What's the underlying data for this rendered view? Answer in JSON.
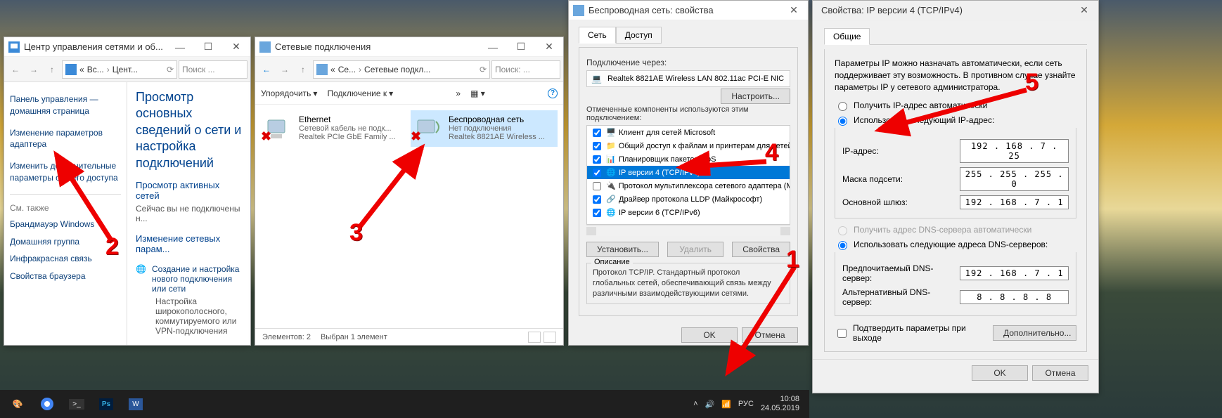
{
  "win1": {
    "title": "Центр управления сетями и об...",
    "breadcrumb": {
      "p1": "Вс...",
      "p2": "Цент..."
    },
    "search_placeholder": "Поиск ...",
    "left": {
      "home": "Панель управления — домашняя страница",
      "adapter": "Изменение параметров адаптера",
      "sharing": "Изменить дополнительные параметры общего доступа",
      "see_also": "См. также",
      "firewall": "Брандмауэр Windows",
      "homegroup": "Домашняя группа",
      "infrared": "Инфракрасная связь",
      "browser": "Свойства браузера"
    },
    "right": {
      "heading": "Просмотр основных сведений о сети и настройка подключений",
      "sub1": "Просмотр активных сетей",
      "sub1b": "Сейчас вы не подключены н...",
      "sub2": "Изменение сетевых парам...",
      "task1": "Создание и настройка нового подключения или сети",
      "task1desc": "Настройка широкополосного, коммутируемого или VPN-подключения"
    }
  },
  "win2": {
    "title": "Сетевые подключения",
    "breadcrumb": {
      "p1": "Се...",
      "p2": "Сетевые подкл..."
    },
    "search_placeholder": "Поиск: ...",
    "menu": {
      "org": "Упорядочить",
      "connect": "Подключение к"
    },
    "adapters": [
      {
        "name": "Ethernet",
        "state": "Сетевой кабель не подк...",
        "dev": "Realtek PCIe GbE Family ..."
      },
      {
        "name": "Беспроводная сеть",
        "state": "Нет подключения",
        "dev": "Realtek 8821AE Wireless ..."
      }
    ],
    "status": {
      "count": "Элементов: 2",
      "sel": "Выбран 1 элемент"
    }
  },
  "win3": {
    "title": "Беспроводная сеть: свойства",
    "tabs": {
      "net": "Сеть",
      "access": "Доступ"
    },
    "conn_via": "Подключение через:",
    "adapter": "Realtek 8821AE Wireless LAN 802.11ac PCI-E NIC",
    "configure": "Настроить...",
    "comp_label": "Отмеченные компоненты используются этим подключением:",
    "components": [
      {
        "checked": true,
        "label": "Клиент для сетей Microsoft"
      },
      {
        "checked": true,
        "label": "Общий доступ к файлам и принтерам для сетей Micro"
      },
      {
        "checked": true,
        "label": "Планировщик пакетов QoS"
      },
      {
        "checked": true,
        "label": "IP версии 4 (TCP/IPv4)",
        "selected": true
      },
      {
        "checked": false,
        "label": "Протокол мультиплексора сетевого адаптера (Майкрос"
      },
      {
        "checked": true,
        "label": "Драйвер протокола LLDP (Майкрософт)"
      },
      {
        "checked": true,
        "label": "IP версии 6 (TCP/IPv6)"
      }
    ],
    "install": "Установить...",
    "remove": "Удалить",
    "props": "Свойства",
    "desc_title": "Описание",
    "desc": "Протокол TCP/IP. Стандартный протокол глобальных сетей, обеспечивающий связь между различными взаимодействующими сетями.",
    "ok": "OK",
    "cancel": "Отмена"
  },
  "win4": {
    "title": "Свойства: IP версии 4 (TCP/IPv4)",
    "tab": "Общие",
    "intro": "Параметры IP можно назначать автоматически, если сеть поддерживает эту возможность. В противном случае узнайте параметры IP у сетевого администратора.",
    "radio_auto": "Получить IP-адрес автоматически",
    "radio_manual": "Использовать следующий IP-адрес:",
    "ip_label": "IP-адрес:",
    "ip_val": "192 . 168 .  7  . 25",
    "mask_label": "Маска подсети:",
    "mask_val": "255 . 255 . 255 .  0",
    "gw_label": "Основной шлюз:",
    "gw_val": "192 . 168 .  7  .  1",
    "dns_auto": "Получить адрес DNS-сервера автоматически",
    "dns_manual": "Использовать следующие адреса DNS-серверов:",
    "dns1_label": "Предпочитаемый DNS-сервер:",
    "dns1_val": "192 . 168 .  7  .  1",
    "dns2_label": "Альтернативный DNS-сервер:",
    "dns2_val": " 8  .  8  .  8  .  8",
    "validate": "Подтвердить параметры при выходе",
    "advanced": "Дополнительно...",
    "ok": "OK",
    "cancel": "Отмена"
  },
  "taskbar": {
    "lang": "РУС",
    "time": "10:08",
    "date": "24.05.2019"
  },
  "markers": {
    "n1": "1",
    "n2": "2",
    "n3": "3",
    "n4": "4",
    "n5": "5"
  }
}
